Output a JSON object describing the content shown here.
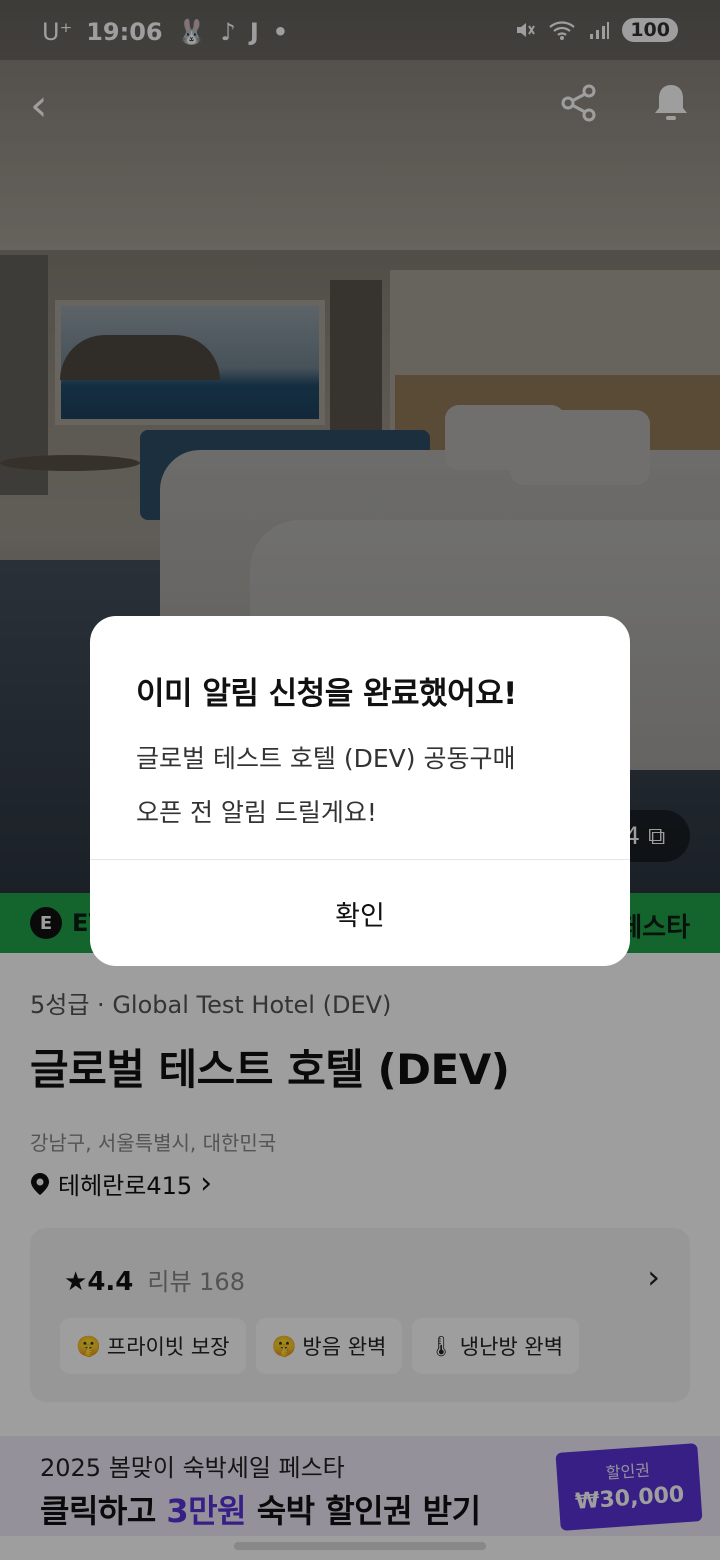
{
  "status_bar": {
    "carrier": "U⁺",
    "time": "19:06",
    "app_icons": [
      "🐰",
      "♪",
      "J",
      "•"
    ],
    "battery": "100"
  },
  "nav": {
    "back_icon": "‹",
    "share_icon": "share-icon",
    "bell_icon": "bell-icon"
  },
  "photo_counter": {
    "text": "4",
    "icon": "⧉"
  },
  "event_banner": {
    "badge": "E",
    "left_text": "EV",
    "right_text": "페스타"
  },
  "hotel": {
    "grade": "5성급 · Global Test Hotel (DEV)",
    "title": "글로벌 테스트 호텔 (DEV)",
    "region": "강남구, 서울특별시, 대한민국",
    "address": "테헤란로415",
    "address_chevron": "›"
  },
  "review": {
    "star": "★",
    "rating": "4.4",
    "count_label": "리뷰 168",
    "chevron": "›",
    "tags": [
      {
        "emoji": "🤫",
        "label": "프라이빗 보장"
      },
      {
        "emoji": "🤫",
        "label": "방음 완벽"
      },
      {
        "emoji": "🌡",
        "label": "냉난방 완벽"
      }
    ]
  },
  "promo": {
    "line1": "2025 봄맞이 숙박세일 페스타",
    "line2_pre": "클릭하고 ",
    "line2_accent": "3만원",
    "line2_post": " 숙박 할인권 받기",
    "coupon_label": "할인권",
    "coupon_amount": "₩30,000"
  },
  "dialog": {
    "title": "이미 알림 신청을 완료했어요!",
    "body_line1": "글로벌 테스트 호텔 (DEV) 공동구매",
    "body_line2": "오픈 전 알림 드릴게요!",
    "confirm": "확인"
  },
  "colors": {
    "event_green": "#1fa34a",
    "promo_purple": "#5a32d8",
    "promo_bg": "#f0ebfb"
  }
}
